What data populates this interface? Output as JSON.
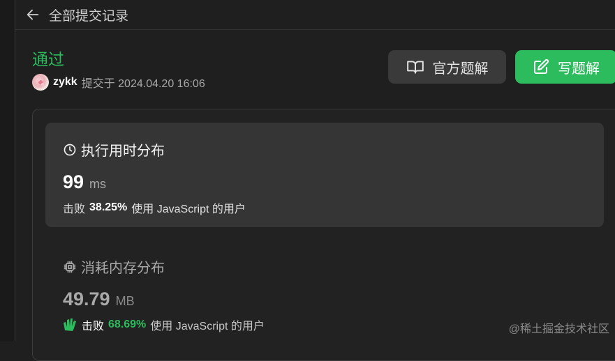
{
  "header": {
    "title": "全部提交记录",
    "back_icon": "arrow-left-icon"
  },
  "submission": {
    "status": "通过",
    "status_color": "#2cbb5d",
    "user": "zykk",
    "submitted_text": "提交于 2024.04.20 16:06"
  },
  "actions": {
    "official_solution": "官方题解",
    "official_icon": "book-open-icon",
    "write_solution": "写题解",
    "write_icon": "edit-icon",
    "write_color": "#2cbb5d"
  },
  "runtime": {
    "title": "执行用时分布",
    "icon": "clock-icon",
    "value": "99",
    "unit": "ms",
    "beat_label": "击败",
    "beat_percent": "38.25%",
    "beat_suffix": "使用 JavaScript 的用户"
  },
  "memory": {
    "title": "消耗内存分布",
    "icon": "chip-icon",
    "value": "49.79",
    "unit": "MB",
    "beat_icon": "clap-icon",
    "beat_label": "击败",
    "beat_percent": "68.69%",
    "beat_suffix": "使用 JavaScript 的用户"
  },
  "watermark": "@稀土掘金技术社区"
}
